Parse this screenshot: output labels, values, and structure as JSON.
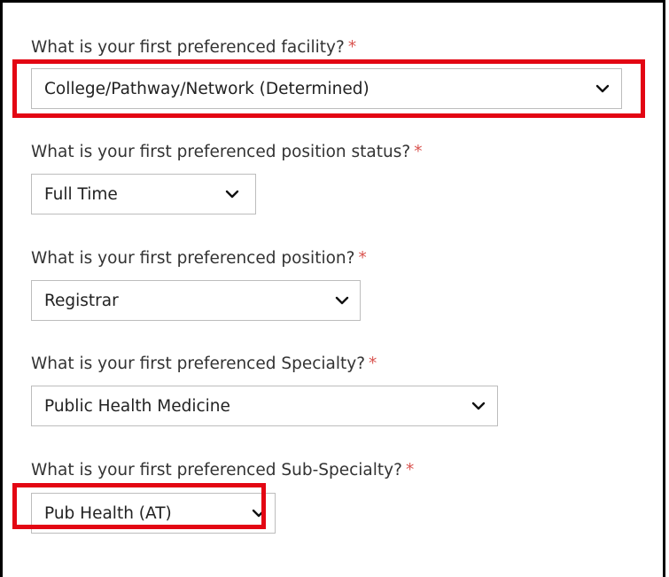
{
  "questions": [
    {
      "label": "What is your first preferenced facility?",
      "required_mark": "*",
      "selected": "College/Pathway/Network (Determined)",
      "chevron_icon": "chevron-down-icon"
    },
    {
      "label": "What is your first preferenced position status?",
      "required_mark": "*",
      "selected": "Full Time",
      "chevron_icon": "chevron-down-icon"
    },
    {
      "label": "What is your first preferenced position?",
      "required_mark": "*",
      "selected": "Registrar",
      "chevron_icon": "chevron-down-icon"
    },
    {
      "label": "What is your first preferenced Specialty?",
      "required_mark": "*",
      "selected": "Public Health Medicine",
      "chevron_icon": "chevron-down-icon"
    },
    {
      "label": "What is your first preferenced Sub-Specialty?",
      "required_mark": "*",
      "selected": "Pub Health (AT)",
      "chevron_icon": "chevron-down-icon"
    }
  ],
  "colors": {
    "required": "#d9534f",
    "highlight": "#e30613",
    "frame": "#000000"
  }
}
